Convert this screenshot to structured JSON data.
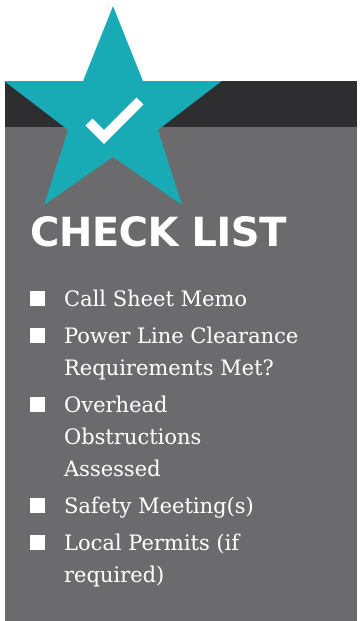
{
  "colors": {
    "background": "#ffffff",
    "card": "#6b6b6e",
    "card_top": "#2e2e30",
    "star": "#18aab5",
    "text": "#ffffff"
  },
  "badge": {
    "icon": "check-star-icon"
  },
  "title": "CHECK LIST",
  "items": [
    {
      "label": "Call Sheet Memo"
    },
    {
      "label": "Power Line Clearance Requirements Met?"
    },
    {
      "label": "Overhead Obstructions Assessed"
    },
    {
      "label": "Safety Meeting(s)"
    },
    {
      "label": "Local Permits (if required)"
    }
  ]
}
